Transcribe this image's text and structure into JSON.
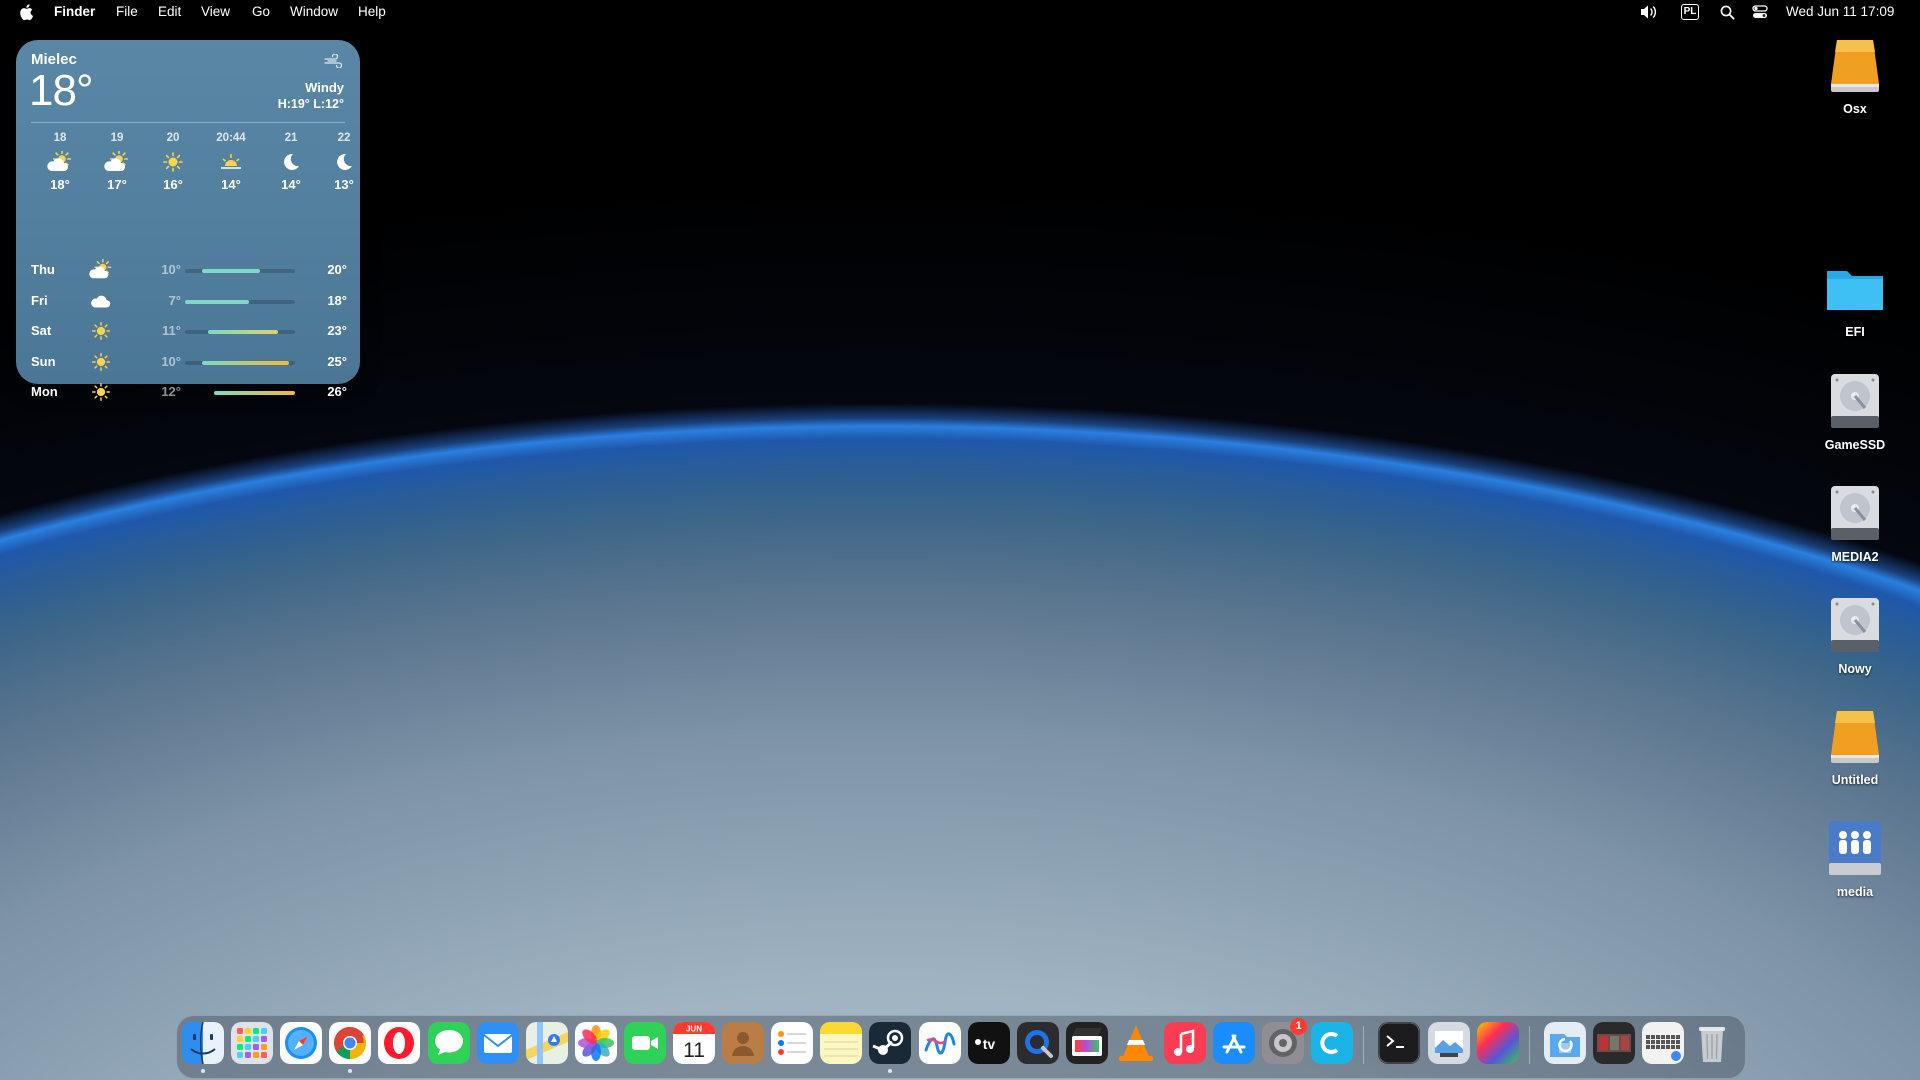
{
  "menubar": {
    "menus": [
      "Finder",
      "File",
      "Edit",
      "View",
      "Go",
      "Window",
      "Help"
    ],
    "status_icons": [
      "speaker-icon",
      "input-source-icon",
      "spotlight-search-icon",
      "control-center-icon"
    ],
    "input_source": "PL",
    "clock": "Wed Jun 11  17:09"
  },
  "weather": {
    "city": "Mielec",
    "temperature": "18°",
    "condition": "Windy",
    "high_low": "H:19° L:12°",
    "hourly": [
      {
        "time": "18",
        "icon": "partly-sunny-icon",
        "temp": "18°"
      },
      {
        "time": "19",
        "icon": "partly-sunny-icon",
        "temp": "17°"
      },
      {
        "time": "20",
        "icon": "sun-icon",
        "temp": "16°"
      },
      {
        "time": "20:44",
        "icon": "sunset-icon",
        "temp": "14°"
      },
      {
        "time": "21",
        "icon": "moon-icon",
        "temp": "14°"
      },
      {
        "time": "22",
        "icon": "moon-icon",
        "temp": "13°"
      }
    ],
    "daily": [
      {
        "day": "Thu",
        "icon": "partly-sunny-icon",
        "low": "10°",
        "high": "20°",
        "low_val": 10,
        "high_val": 20
      },
      {
        "day": "Fri",
        "icon": "cloud-icon",
        "low": "7°",
        "high": "18°",
        "low_val": 7,
        "high_val": 18
      },
      {
        "day": "Sat",
        "icon": "sun-icon",
        "low": "11°",
        "high": "23°",
        "low_val": 11,
        "high_val": 23
      },
      {
        "day": "Sun",
        "icon": "sun-icon",
        "low": "10°",
        "high": "25°",
        "low_val": 10,
        "high_val": 25
      },
      {
        "day": "Mon",
        "icon": "sun-icon",
        "low": "12°",
        "high": "26°",
        "low_val": 12,
        "high_val": 26
      }
    ]
  },
  "desktop_icons": [
    {
      "label": "Osx",
      "icon": "orange-drive-icon"
    },
    {
      "label": "EFI",
      "icon": "folder-icon"
    },
    {
      "label": "GameSSD",
      "icon": "hard-drive-icon"
    },
    {
      "label": "MEDIA2",
      "icon": "hard-drive-icon"
    },
    {
      "label": "Nowy",
      "icon": "hard-drive-icon"
    },
    {
      "label": "Untitled",
      "icon": "orange-drive-icon"
    },
    {
      "label": "media",
      "icon": "network-share-icon"
    }
  ],
  "dock": {
    "apps": [
      "Finder",
      "Launchpad",
      "Safari",
      "Google Chrome",
      "Opera",
      "Messages",
      "Mail",
      "Maps",
      "Photos",
      "FaceTime",
      "Calendar",
      "Contacts",
      "Reminders",
      "Notes",
      "Steam",
      "Freeform",
      "TV",
      "QuickTime Player",
      "Final Cut Pro",
      "VLC",
      "Music",
      "App Store",
      "System Settings",
      "Cleaner",
      "Terminal",
      "Preview",
      "Color Picker",
      "Downloads",
      "Screenshots",
      "Keyboard",
      "Trash"
    ],
    "calendar_month": "JUN",
    "calendar_day": "11",
    "settings_badge": "1"
  }
}
